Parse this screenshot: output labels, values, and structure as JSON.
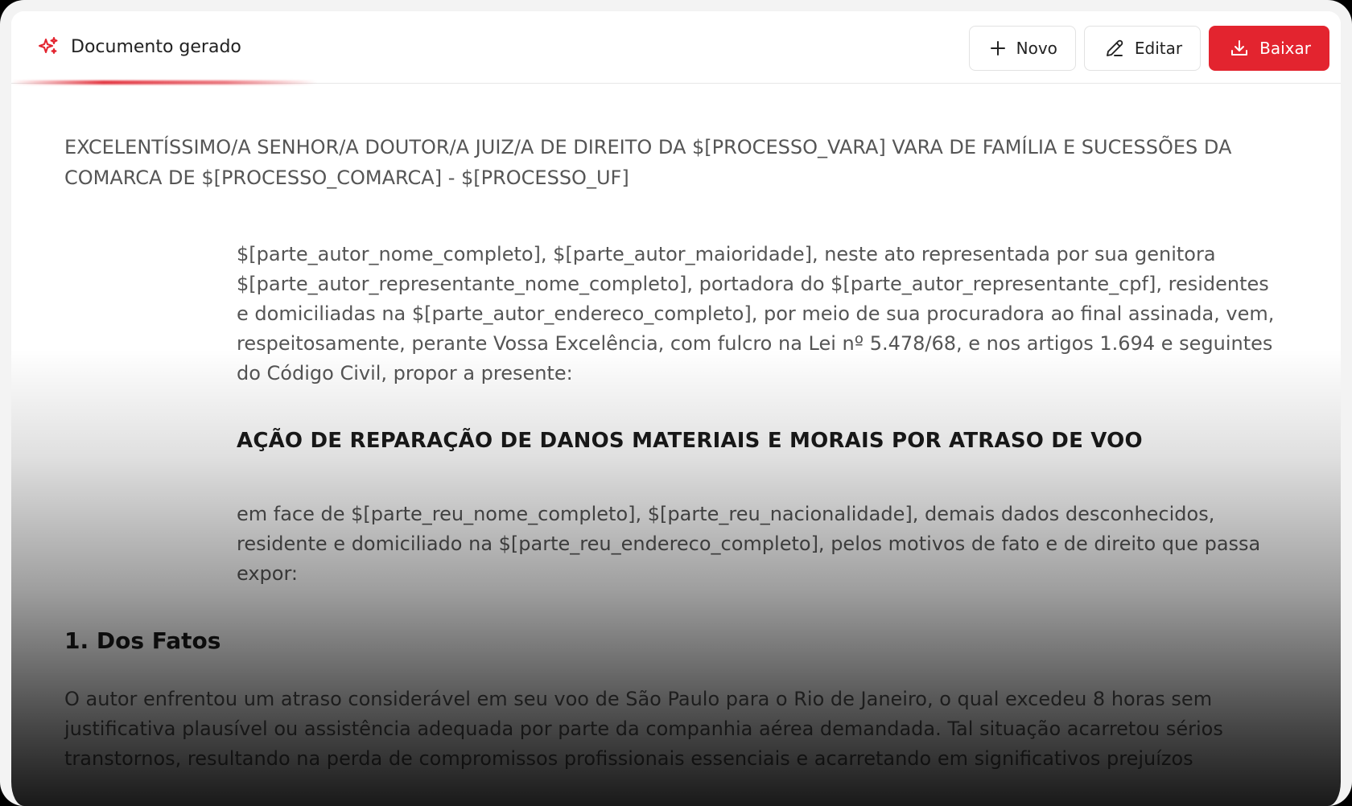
{
  "header": {
    "title": "Documento gerado",
    "icon": "sparkle-icon",
    "accent_color": "#e3242f"
  },
  "toolbar": {
    "new_label": "Novo",
    "edit_label": "Editar",
    "download_label": "Baixar"
  },
  "document": {
    "address": "EXCELENTÍSSIMO/A SENHOR/A DOUTOR/A JUIZ/A DE DIREITO DA $[PROCESSO_VARA] VARA DE FAMÍLIA E SUCESSÕES DA COMARCA DE $[PROCESSO_COMARCA] - $[PROCESSO_UF]",
    "qualification": "$[parte_autor_nome_completo], $[parte_autor_maioridade], neste ato representada por sua genitora $[parte_autor_representante_nome_completo], portadora do $[parte_autor_representante_cpf], residentes e domiciliadas na $[parte_autor_endereco_completo], por meio de sua procuradora ao final assinada, vem, respeitosamente, perante Vossa Excelência, com fulcro na Lei nº 5.478/68, e nos artigos 1.694 e seguintes do Código Civil, propor a presente:",
    "action_title": "AÇÃO DE REPARAÇÃO DE DANOS MATERIAIS E MORAIS POR ATRASO DE VOO",
    "against": "em face de $[parte_reu_nome_completo], $[parte_reu_nacionalidade], demais dados desconhecidos, residente e domiciliado na $[parte_reu_endereco_completo], pelos motivos de fato e de direito que passa expor:",
    "section_1_title": "1. Dos Fatos",
    "section_1_text": "O autor enfrentou um atraso considerável em seu voo de São Paulo para o Rio de Janeiro, o qual excedeu 8 horas sem justificativa plausível ou assistência adequada por parte da companhia aérea demandada. Tal situação acarretou sérios transtornos, resultando na perda de compromissos profissionais essenciais e acarretando em significativos prejuízos"
  }
}
